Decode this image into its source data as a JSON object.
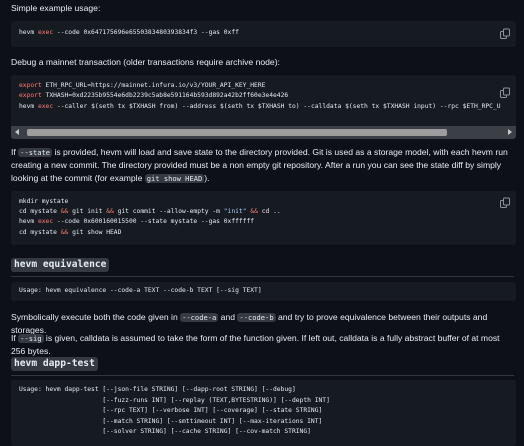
{
  "intro": {
    "simple_usage": "Simple example usage:",
    "debug_mainnet": "Debug a mainnet transaction (older transactions require archive node):"
  },
  "code1": {
    "cmd": "hevm",
    "kw": "exec",
    "rest": " --code 0x647175696e6550383480393834f3 --gas 0xff"
  },
  "code2": {
    "line1_kw": "export",
    "line1_rest": " ETH_RPC_URL=https://mainnet.infura.io/v3/YOUR_API_KEY_HERE",
    "line2_kw": "export",
    "line2_rest": " TXHASH=0xd2235b9554e6db2239c5ab8e591164b593d892a42b2ff60e3e4e426",
    "line3_cmd": "hevm",
    "line3_kw": "exec",
    "line3_a": " --caller ",
    "line3_b": "$(seth tx $TXHASH from)",
    "line3_c": " --address ",
    "line3_d": "$(seth tx $TXHASH to)",
    "line3_e": " --calldata ",
    "line3_f": "$(seth tx $TXHASH input)",
    "line3_g": " --rpc $ETH_RPC_U"
  },
  "para_state": {
    "if": "If ",
    "flag": "--state",
    "text1": " is provided, hevm will load and save state to the directory provided. Git is used as a storage model, with each hevm run creating a new commit. The directory provided must be a non empty git repository. After a run you can see the state diff by simply looking at the commit (for example ",
    "example": "git show HEAD",
    "text2": ")."
  },
  "code3": {
    "l1": "mkdir mystate",
    "l2_a": "cd mystate ",
    "l2_b": "&&",
    "l2_c": " git init ",
    "l2_d": "&&",
    "l2_e": " git commit --allow-empty -m ",
    "l2_f": "\"init\"",
    "l2_g": " ",
    "l2_h": "&&",
    "l2_i": " cd ..",
    "l3_cmd": "hevm",
    "l3_kw": "exec",
    "l3_rest": " --code 0x600160015500 --state mystate --gas 0xffffff",
    "l4_a": "cd mystate ",
    "l4_b": "&&",
    "l4_c": " git show HEAD"
  },
  "section_equivalence": {
    "heading": "hevm equivalence",
    "usage": "Usage: hevm equivalence --code-a TEXT --code-b TEXT [--sig TEXT]",
    "p1_a": "Symbolically execute both the code given in ",
    "p1_code_a": "--code-a",
    "p1_b": " and ",
    "p1_code_b": "--code-b",
    "p1_c": " and try to prove equivalence between their outputs and storages.",
    "p2_if": "If ",
    "p2_sig": "--sig",
    "p2_rest": " is given, calldata is assumed to take the form of the function given. If left out, calldata is a fully abstract buffer of at most 256 bytes."
  },
  "section_dapp_test": {
    "heading": "hevm dapp-test",
    "usage_lines": [
      "Usage: hevm dapp-test [--json-file STRING] [--dapp-root STRING] [--debug]",
      "                      [--fuzz-runs INT] [--replay (TEXT,BYTESTRING)] [--depth INT]",
      "                      [--rpc TEXT] [--verbose INT] [--coverage] [--state STRING]",
      "                      [--match STRING] [--smttimeout INT] [--max-iterations INT]",
      "                      [--solver STRING] [--cache STRING] [--cov-match STRING]"
    ]
  },
  "icons": {
    "copy": "copy-icon"
  },
  "colors": {
    "background": "#0d1117",
    "code_background": "#161b22",
    "keyword": "#ff7b72",
    "text": "#e6edf3",
    "inline_code_background": "#343942"
  }
}
